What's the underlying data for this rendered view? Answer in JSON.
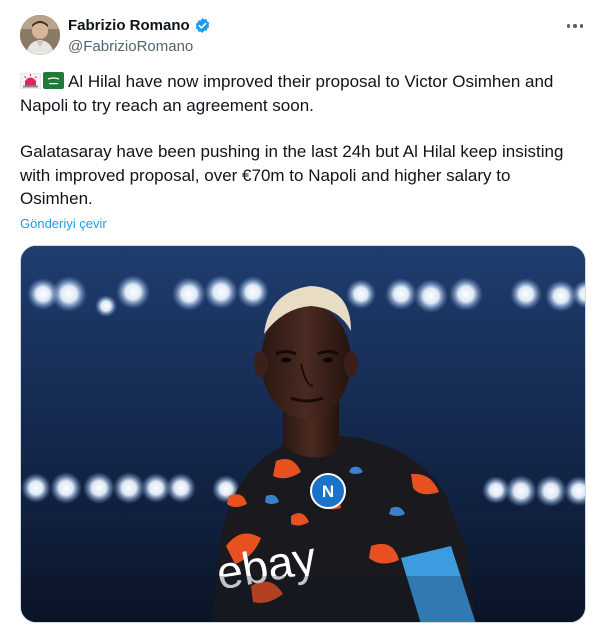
{
  "author": {
    "name": "Fabrizio Romano",
    "handle": "@FabrizioRomano"
  },
  "icons": {
    "verified": "verified-badge-icon",
    "more": "more-options-icon",
    "siren": "police-light-emoji",
    "flag": "saudi-arabia-flag-emoji"
  },
  "tweet": {
    "paragraph1": "Al Hilal have now improved their proposal to Victor Osimhen and Napoli to try reach an agreement soon.",
    "paragraph2": "Galatasaray have been pushing in the last 24h but Al Hilal keep insisting with improved proposal, over €70m to Napoli and higher salary to Osimhen.",
    "translate_label": "Gönderiyi çevir"
  },
  "media": {
    "shirt_text": "ebay"
  },
  "colors": {
    "link": "#1d9bf0",
    "verified": "#1d9bf0",
    "secondary_text": "#536471"
  }
}
